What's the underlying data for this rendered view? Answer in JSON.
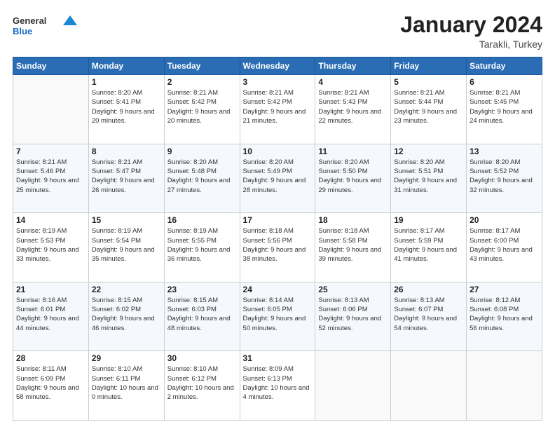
{
  "logo": {
    "general": "General",
    "blue": "Blue"
  },
  "header": {
    "month": "January 2024",
    "location": "Tarakli, Turkey"
  },
  "days_of_week": [
    "Sunday",
    "Monday",
    "Tuesday",
    "Wednesday",
    "Thursday",
    "Friday",
    "Saturday"
  ],
  "weeks": [
    [
      {
        "day": "",
        "sunrise": "",
        "sunset": "",
        "daylight": ""
      },
      {
        "day": "1",
        "sunrise": "Sunrise: 8:20 AM",
        "sunset": "Sunset: 5:41 PM",
        "daylight": "Daylight: 9 hours and 20 minutes."
      },
      {
        "day": "2",
        "sunrise": "Sunrise: 8:21 AM",
        "sunset": "Sunset: 5:42 PM",
        "daylight": "Daylight: 9 hours and 20 minutes."
      },
      {
        "day": "3",
        "sunrise": "Sunrise: 8:21 AM",
        "sunset": "Sunset: 5:42 PM",
        "daylight": "Daylight: 9 hours and 21 minutes."
      },
      {
        "day": "4",
        "sunrise": "Sunrise: 8:21 AM",
        "sunset": "Sunset: 5:43 PM",
        "daylight": "Daylight: 9 hours and 22 minutes."
      },
      {
        "day": "5",
        "sunrise": "Sunrise: 8:21 AM",
        "sunset": "Sunset: 5:44 PM",
        "daylight": "Daylight: 9 hours and 23 minutes."
      },
      {
        "day": "6",
        "sunrise": "Sunrise: 8:21 AM",
        "sunset": "Sunset: 5:45 PM",
        "daylight": "Daylight: 9 hours and 24 minutes."
      }
    ],
    [
      {
        "day": "7",
        "sunrise": "Sunrise: 8:21 AM",
        "sunset": "Sunset: 5:46 PM",
        "daylight": "Daylight: 9 hours and 25 minutes."
      },
      {
        "day": "8",
        "sunrise": "Sunrise: 8:21 AM",
        "sunset": "Sunset: 5:47 PM",
        "daylight": "Daylight: 9 hours and 26 minutes."
      },
      {
        "day": "9",
        "sunrise": "Sunrise: 8:20 AM",
        "sunset": "Sunset: 5:48 PM",
        "daylight": "Daylight: 9 hours and 27 minutes."
      },
      {
        "day": "10",
        "sunrise": "Sunrise: 8:20 AM",
        "sunset": "Sunset: 5:49 PM",
        "daylight": "Daylight: 9 hours and 28 minutes."
      },
      {
        "day": "11",
        "sunrise": "Sunrise: 8:20 AM",
        "sunset": "Sunset: 5:50 PM",
        "daylight": "Daylight: 9 hours and 29 minutes."
      },
      {
        "day": "12",
        "sunrise": "Sunrise: 8:20 AM",
        "sunset": "Sunset: 5:51 PM",
        "daylight": "Daylight: 9 hours and 31 minutes."
      },
      {
        "day": "13",
        "sunrise": "Sunrise: 8:20 AM",
        "sunset": "Sunset: 5:52 PM",
        "daylight": "Daylight: 9 hours and 32 minutes."
      }
    ],
    [
      {
        "day": "14",
        "sunrise": "Sunrise: 8:19 AM",
        "sunset": "Sunset: 5:53 PM",
        "daylight": "Daylight: 9 hours and 33 minutes."
      },
      {
        "day": "15",
        "sunrise": "Sunrise: 8:19 AM",
        "sunset": "Sunset: 5:54 PM",
        "daylight": "Daylight: 9 hours and 35 minutes."
      },
      {
        "day": "16",
        "sunrise": "Sunrise: 8:19 AM",
        "sunset": "Sunset: 5:55 PM",
        "daylight": "Daylight: 9 hours and 36 minutes."
      },
      {
        "day": "17",
        "sunrise": "Sunrise: 8:18 AM",
        "sunset": "Sunset: 5:56 PM",
        "daylight": "Daylight: 9 hours and 38 minutes."
      },
      {
        "day": "18",
        "sunrise": "Sunrise: 8:18 AM",
        "sunset": "Sunset: 5:58 PM",
        "daylight": "Daylight: 9 hours and 39 minutes."
      },
      {
        "day": "19",
        "sunrise": "Sunrise: 8:17 AM",
        "sunset": "Sunset: 5:59 PM",
        "daylight": "Daylight: 9 hours and 41 minutes."
      },
      {
        "day": "20",
        "sunrise": "Sunrise: 8:17 AM",
        "sunset": "Sunset: 6:00 PM",
        "daylight": "Daylight: 9 hours and 43 minutes."
      }
    ],
    [
      {
        "day": "21",
        "sunrise": "Sunrise: 8:16 AM",
        "sunset": "Sunset: 6:01 PM",
        "daylight": "Daylight: 9 hours and 44 minutes."
      },
      {
        "day": "22",
        "sunrise": "Sunrise: 8:15 AM",
        "sunset": "Sunset: 6:02 PM",
        "daylight": "Daylight: 9 hours and 46 minutes."
      },
      {
        "day": "23",
        "sunrise": "Sunrise: 8:15 AM",
        "sunset": "Sunset: 6:03 PM",
        "daylight": "Daylight: 9 hours and 48 minutes."
      },
      {
        "day": "24",
        "sunrise": "Sunrise: 8:14 AM",
        "sunset": "Sunset: 6:05 PM",
        "daylight": "Daylight: 9 hours and 50 minutes."
      },
      {
        "day": "25",
        "sunrise": "Sunrise: 8:13 AM",
        "sunset": "Sunset: 6:06 PM",
        "daylight": "Daylight: 9 hours and 52 minutes."
      },
      {
        "day": "26",
        "sunrise": "Sunrise: 8:13 AM",
        "sunset": "Sunset: 6:07 PM",
        "daylight": "Daylight: 9 hours and 54 minutes."
      },
      {
        "day": "27",
        "sunrise": "Sunrise: 8:12 AM",
        "sunset": "Sunset: 6:08 PM",
        "daylight": "Daylight: 9 hours and 56 minutes."
      }
    ],
    [
      {
        "day": "28",
        "sunrise": "Sunrise: 8:11 AM",
        "sunset": "Sunset: 6:09 PM",
        "daylight": "Daylight: 9 hours and 58 minutes."
      },
      {
        "day": "29",
        "sunrise": "Sunrise: 8:10 AM",
        "sunset": "Sunset: 6:11 PM",
        "daylight": "Daylight: 10 hours and 0 minutes."
      },
      {
        "day": "30",
        "sunrise": "Sunrise: 8:10 AM",
        "sunset": "Sunset: 6:12 PM",
        "daylight": "Daylight: 10 hours and 2 minutes."
      },
      {
        "day": "31",
        "sunrise": "Sunrise: 8:09 AM",
        "sunset": "Sunset: 6:13 PM",
        "daylight": "Daylight: 10 hours and 4 minutes."
      },
      {
        "day": "",
        "sunrise": "",
        "sunset": "",
        "daylight": ""
      },
      {
        "day": "",
        "sunrise": "",
        "sunset": "",
        "daylight": ""
      },
      {
        "day": "",
        "sunrise": "",
        "sunset": "",
        "daylight": ""
      }
    ]
  ]
}
